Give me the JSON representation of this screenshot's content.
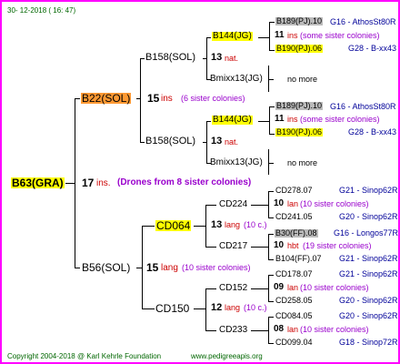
{
  "header": {
    "date": "30-  12-2018  (  16:  47)"
  },
  "root": {
    "name": "B63(GRA)",
    "gen": "17",
    "ins": "ins.",
    "note": "(Drones from 8 sister colonies)"
  },
  "sire": {
    "name": "B22(SOL)",
    "gen": "15",
    "ins": "ins",
    "note": "(6 sister colonies)"
  },
  "dam": {
    "name": "B56(SOL)",
    "gen": "15",
    "lang": "lang",
    "note": "(10 sister colonies)"
  },
  "b158a": {
    "name": "B158(SOL)",
    "gen": "13",
    "nat": "nat."
  },
  "b158b": {
    "name": "B158(SOL)",
    "gen": "13",
    "nat": "nat."
  },
  "b144a": {
    "name": "B144(JG)",
    "gen": "11",
    "ins": "ins",
    "note": "(some sister colonies)"
  },
  "bmix_a": {
    "name": "Bmixx13(JG)",
    "more": "no more"
  },
  "b144b": {
    "name": "B144(JG)",
    "gen": "11",
    "ins": "ins",
    "note": "(some sister colonies)"
  },
  "bmix_b": {
    "name": "Bmixx13(JG)",
    "more": "no more"
  },
  "top1": {
    "a": "B189(PJ).10",
    "a_code": "G16 - AthosSt80R",
    "b": "B190(PJ).06",
    "b_code": "G28 - B-xx43"
  },
  "top2": {
    "a": "B189(PJ).10",
    "a_code": "G16 - AthosSt80R",
    "b": "B190(PJ).06",
    "b_code": "G28 - B-xx43"
  },
  "cd064": {
    "name": "CD064",
    "gen": "13",
    "lang": "lang",
    "note": "(10 c.)"
  },
  "cd150": {
    "name": "CD150",
    "gen": "12",
    "lang": "lang",
    "note": "(10 c.)"
  },
  "cd224": {
    "name": "CD224",
    "gen": "10",
    "lang": "lan",
    "note": "(10 sister colonies)",
    "a": "CD278.07",
    "a_code": "G21 - Sinop62R",
    "b": "CD241.05",
    "b_code": "G20 - Sinop62R"
  },
  "cd217": {
    "name": "CD217",
    "gen": "10",
    "lang": "hbt",
    "note": "(19 sister colonies)",
    "a": "B30(FF).08",
    "a_code": "G16 - Longos77R",
    "b": "B104(FF).07",
    "b_code": "G21 - Sinop62R"
  },
  "cd152": {
    "name": "CD152",
    "gen": "09",
    "lang": "lan",
    "note": "(10 sister colonies)",
    "a": "CD178.07",
    "a_code": "G21 - Sinop62R",
    "b": "CD258.05",
    "b_code": "G20 - Sinop62R"
  },
  "cd233": {
    "name": "CD233",
    "gen": "08",
    "lang": "lan",
    "note": "(10 sister colonies)",
    "a": "CD084.05",
    "a_code": "G20 - Sinop62R",
    "b": "CD099.04",
    "b_code": "G18 - Sinop72R"
  },
  "footer": {
    "copyright": "Copyright 2004-2018 @ Karl Kehrle Foundation",
    "url": "www.pedigreeapis.org"
  },
  "colors": {
    "border": "#ff00ff",
    "highlight_yellow": "#ffff00",
    "highlight_orange": "#ff9933",
    "highlight_grey": "#bbbbbb",
    "code_blue": "#000099",
    "note_purple": "#9900cc"
  }
}
